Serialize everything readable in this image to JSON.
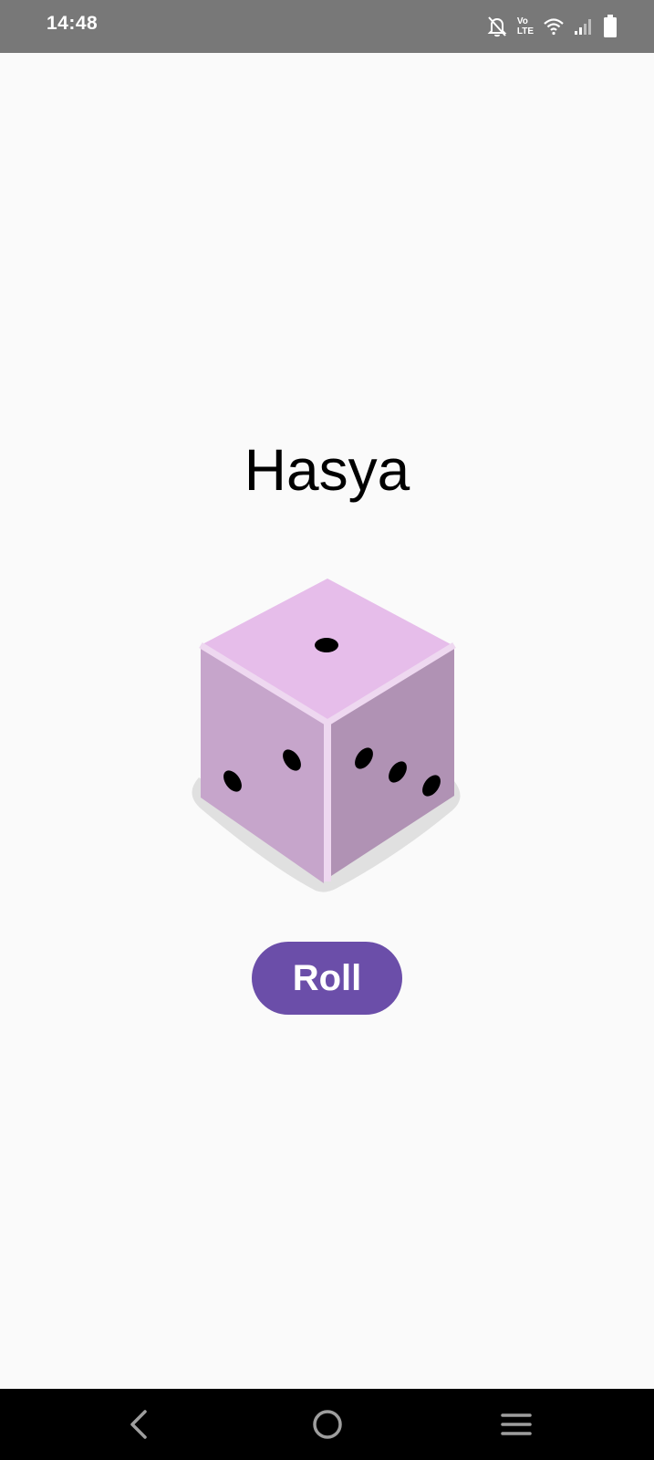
{
  "status_bar": {
    "time": "14:48",
    "icons": [
      "bell-off-icon",
      "volte-icon",
      "wifi-icon",
      "signal-icon",
      "battery-icon"
    ],
    "volte_label_top": "Vo",
    "volte_label_bottom": "LTE"
  },
  "main": {
    "title": "Hasya",
    "roll_button_label": "Roll",
    "dice": {
      "top_face_pips": 1,
      "left_face_pips": 2,
      "right_face_pips": 3,
      "top_color": "#e6bdea",
      "left_color": "#c6a5cb",
      "right_color": "#b092b4",
      "edge_color": "#eed8f0",
      "shadow_color": "#e0e0e0"
    },
    "accent_color": "#6b4ea9"
  },
  "nav_bar": {
    "items": [
      "back-icon",
      "home-icon",
      "menu-icon"
    ]
  }
}
